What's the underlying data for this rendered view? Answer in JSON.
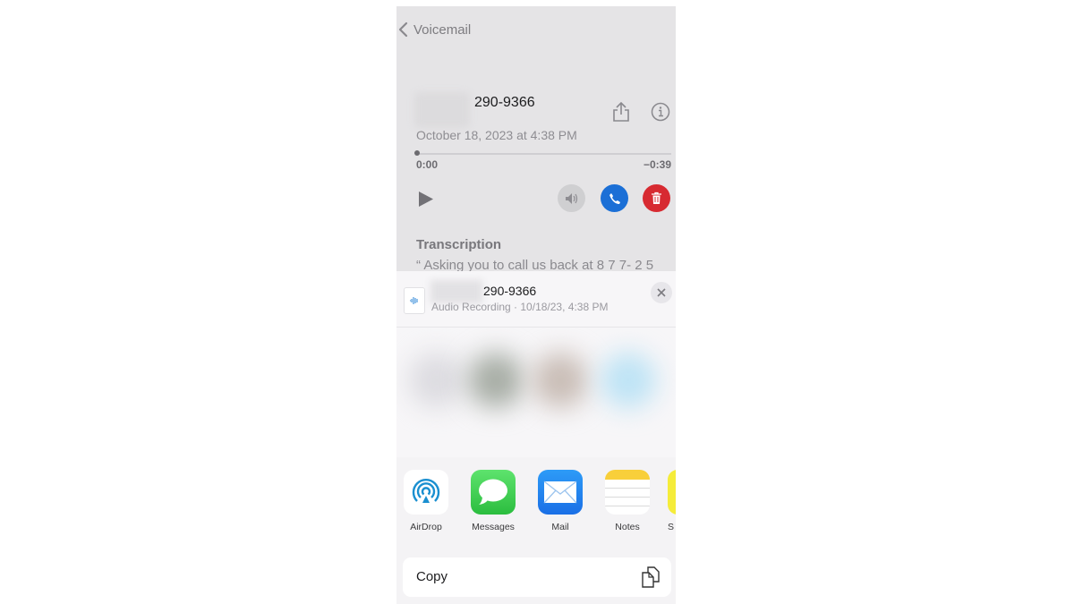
{
  "nav": {
    "back_label": "Voicemail"
  },
  "voicemail": {
    "number": "290-9366",
    "date": "October 18, 2023 at 4:38 PM",
    "time_elapsed": "0:00",
    "time_remaining": "−0:39",
    "progress": 0,
    "transcription_title": "Transcription",
    "transcription_text": "“ Asking you to call us back at 8 7 7- 2 5"
  },
  "share_sheet": {
    "title": "290-9366",
    "subtitle": "Audio Recording · 10/18/23, 4:38 PM",
    "apps": [
      {
        "label": "AirDrop",
        "icon": "airdrop-icon"
      },
      {
        "label": "Messages",
        "icon": "messages-icon"
      },
      {
        "label": "Mail",
        "icon": "mail-icon"
      },
      {
        "label": "Notes",
        "icon": "notes-icon"
      },
      {
        "label": "S",
        "icon": "app-icon"
      }
    ],
    "copy_label": "Copy"
  },
  "colors": {
    "call": "#1b6fd6",
    "delete": "#d72a31",
    "airdrop": "#1a8fd0",
    "messages": "#34c759",
    "mail": "#1e8cf0",
    "notes": "#f8cf3a"
  }
}
